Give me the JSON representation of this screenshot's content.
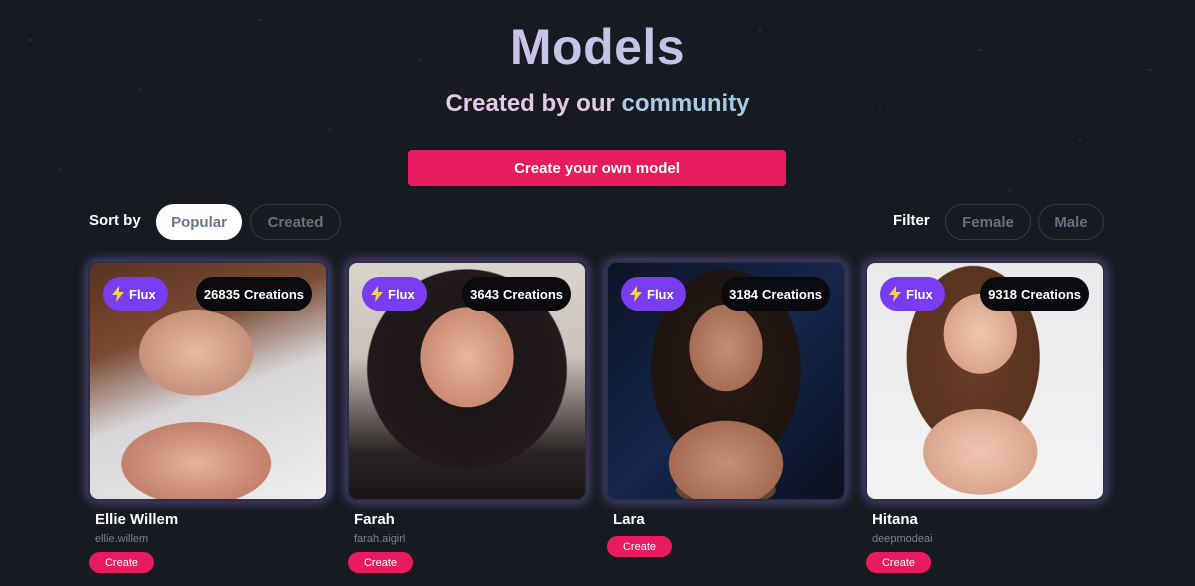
{
  "header": {
    "title": "Models",
    "subtitle_part1": "Created by our ",
    "subtitle_part2": "community",
    "create_own_label": "Create your own model"
  },
  "sort": {
    "label": "Sort by",
    "options": [
      "Popular",
      "Created"
    ],
    "selected": "Popular"
  },
  "filter": {
    "label": "Filter",
    "options": [
      "Female",
      "Male"
    ]
  },
  "colors": {
    "accent": "#e81b5f",
    "flux_badge": "#7a3cf0",
    "background": "#181a22"
  },
  "models": [
    {
      "badge": "Flux",
      "badge_icon": "lightning-icon",
      "creations_count": "26835",
      "creations_suffix": "Creations",
      "name": "Ellie Willem",
      "handle": "ellie.willem",
      "button": "Create"
    },
    {
      "badge": "Flux",
      "badge_icon": "lightning-icon",
      "creations_count": "3643",
      "creations_suffix": "Creations",
      "name": "Farah",
      "handle": "farah.aigirl",
      "button": "Create"
    },
    {
      "badge": "Flux",
      "badge_icon": "lightning-icon",
      "creations_count": "3184",
      "creations_suffix": "Creations",
      "name": "Lara",
      "handle": "",
      "button": "Create"
    },
    {
      "badge": "Flux",
      "badge_icon": "lightning-icon",
      "creations_count": "9318",
      "creations_suffix": "Creations",
      "name": "Hitana",
      "handle": "deepmodeai",
      "button": "Create"
    }
  ]
}
